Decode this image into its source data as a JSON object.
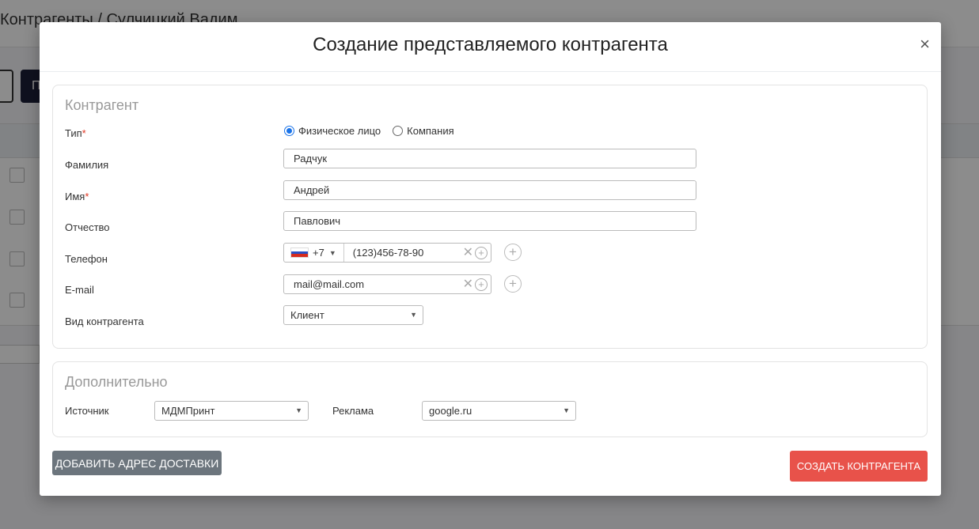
{
  "background": {
    "breadcrumb": "Контрагенты / Сулчицкий Вадим",
    "button_label": "П"
  },
  "modal": {
    "title": "Создание представляемого контрагента",
    "close": "×"
  },
  "contractor": {
    "section_title": "Контрагент",
    "type_label": "Тип",
    "required_mark": "*",
    "type_options": [
      "Физическое лицо",
      "Компания"
    ],
    "type_selected": "Физическое лицо",
    "surname_label": "Фамилия",
    "surname_value": "Радчук",
    "name_label": "Имя",
    "name_value": "Андрей",
    "patronymic_label": "Отчество",
    "patronymic_value": "Павлович",
    "phone_label": "Телефон",
    "phone_code": "+7",
    "phone_value": "(123)456-78-90",
    "email_label": "E-mail",
    "email_value": "mail@mail.com",
    "kind_label": "Вид контрагента",
    "kind_value": "Клиент"
  },
  "extra": {
    "section_title": "Дополнительно",
    "source_label": "Источник",
    "source_value": "МДМПринт",
    "ad_label": "Реклама",
    "ad_value": "google.ru"
  },
  "actions": {
    "add_address": "ДОБАВИТЬ АДРЕС ДОСТАВКИ",
    "create": "СОЗДАТЬ КОНТРАГЕНТА"
  },
  "colors": {
    "primary_radio": "#1a73e8",
    "create_button": "#e8524a",
    "secondary_button": "#6c757d",
    "required": "#e0341f"
  },
  "icons": {
    "clear": "clear-icon",
    "add": "plus-circle-icon",
    "dropdown": "chevron-down-icon",
    "flag": "russia-flag-icon"
  }
}
